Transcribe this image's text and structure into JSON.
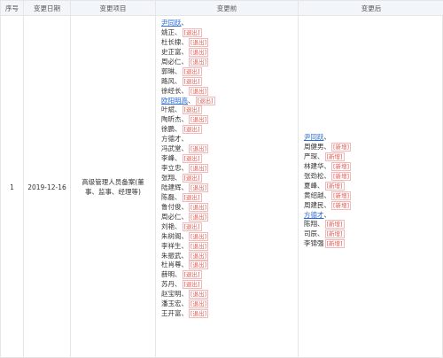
{
  "headers": {
    "index": "序号",
    "date": "变更日期",
    "item": "变更项目",
    "before": "变更前",
    "after": "变更后"
  },
  "row": {
    "index": "1",
    "date": "2019-12-16",
    "item": "高级管理人员备案(董事、监事、经理等)"
  },
  "before_list": [
    {
      "name": "尹同跃",
      "sep": "、",
      "tag": "",
      "link": true
    },
    {
      "name": "姚正",
      "sep": "、",
      "tag": "[退出]",
      "link": false
    },
    {
      "name": "杜长棣",
      "sep": "、",
      "tag": "[退出]",
      "link": false
    },
    {
      "name": "史正富",
      "sep": "、",
      "tag": "[退出]",
      "link": false
    },
    {
      "name": "周必仁",
      "sep": "、",
      "tag": "[退出]",
      "link": false
    },
    {
      "name": "郭琳",
      "sep": "、",
      "tag": "[退出]",
      "link": false
    },
    {
      "name": "路风",
      "sep": "、",
      "tag": "[退出]",
      "link": false
    },
    {
      "name": "徐经长",
      "sep": "、",
      "tag": "[退出]",
      "link": false
    },
    {
      "name": "欧阳明高",
      "sep": "、",
      "tag": "[退出]",
      "link": true
    },
    {
      "name": "叶斌",
      "sep": "、",
      "tag": "[退出]",
      "link": false
    },
    {
      "name": "陶昕杰",
      "sep": "、",
      "tag": "[退出]",
      "link": false
    },
    {
      "name": "徐鹏",
      "sep": "、",
      "tag": "[退出]",
      "link": false
    },
    {
      "name": "方德才",
      "sep": "、",
      "tag": "",
      "link": false
    },
    {
      "name": "冯武堂",
      "sep": "、",
      "tag": "[退出]",
      "link": false
    },
    {
      "name": "李峰",
      "sep": "、",
      "tag": "[退出]",
      "link": false
    },
    {
      "name": "李立忠",
      "sep": "、",
      "tag": "[退出]",
      "link": false
    },
    {
      "name": "张翔",
      "sep": "、",
      "tag": "[退出]",
      "link": false
    },
    {
      "name": "陆建辉",
      "sep": "、",
      "tag": "[退出]",
      "link": false
    },
    {
      "name": "陈磊",
      "sep": "、",
      "tag": "[退出]",
      "link": false
    },
    {
      "name": "鲁付俊",
      "sep": "、",
      "tag": "[退出]",
      "link": false
    },
    {
      "name": "周必仁",
      "sep": "、",
      "tag": "[退出]",
      "link": false
    },
    {
      "name": "刘艳",
      "sep": "、",
      "tag": "[退出]",
      "link": false
    },
    {
      "name": "朱树阁",
      "sep": "、",
      "tag": "[退出]",
      "link": false
    },
    {
      "name": "李祥生",
      "sep": "、",
      "tag": "[退出]",
      "link": false
    },
    {
      "name": "朱振武",
      "sep": "、",
      "tag": "[退出]",
      "link": false
    },
    {
      "name": "杜肖尊",
      "sep": "、",
      "tag": "[退出]",
      "link": false
    },
    {
      "name": "薛明",
      "sep": "、",
      "tag": "[退出]",
      "link": false
    },
    {
      "name": "苏丹",
      "sep": "、",
      "tag": "[退出]",
      "link": false
    },
    {
      "name": "赵宝明",
      "sep": "、",
      "tag": "[退出]",
      "link": false
    },
    {
      "name": "潘玉宏",
      "sep": "、",
      "tag": "[退出]",
      "link": false
    },
    {
      "name": "王开富",
      "sep": "、",
      "tag": "[退出]",
      "link": false
    }
  ],
  "after_list": [
    {
      "name": "尹同跃",
      "sep": "、",
      "tag": "",
      "link": true
    },
    {
      "name": "周健男",
      "sep": "、",
      "tag": "[新增]",
      "link": false
    },
    {
      "name": "严琛",
      "sep": "、",
      "tag": "[新增]",
      "link": false
    },
    {
      "name": "林建华",
      "sep": "、",
      "tag": "[新增]",
      "link": false
    },
    {
      "name": "张劲松",
      "sep": "、",
      "tag": "[新增]",
      "link": false
    },
    {
      "name": "夏峰",
      "sep": "、",
      "tag": "[新增]",
      "link": false
    },
    {
      "name": "黄绍越",
      "sep": "、",
      "tag": "[新增]",
      "link": false
    },
    {
      "name": "周建民",
      "sep": "、",
      "tag": "[新增]",
      "link": false
    },
    {
      "name": "方德才",
      "sep": "、",
      "tag": "",
      "link": true
    },
    {
      "name": "陈翔",
      "sep": "、",
      "tag": "[新增]",
      "link": false
    },
    {
      "name": "司辰",
      "sep": "、",
      "tag": "[新增]",
      "link": false
    },
    {
      "name": "李锦强",
      "sep": "",
      "tag": "[新增]",
      "link": false
    }
  ],
  "colors": {
    "header_bg": "#f2f5fa",
    "border": "#e6e6e6",
    "link": "#2b6cd6",
    "tag": "#e0584f"
  }
}
